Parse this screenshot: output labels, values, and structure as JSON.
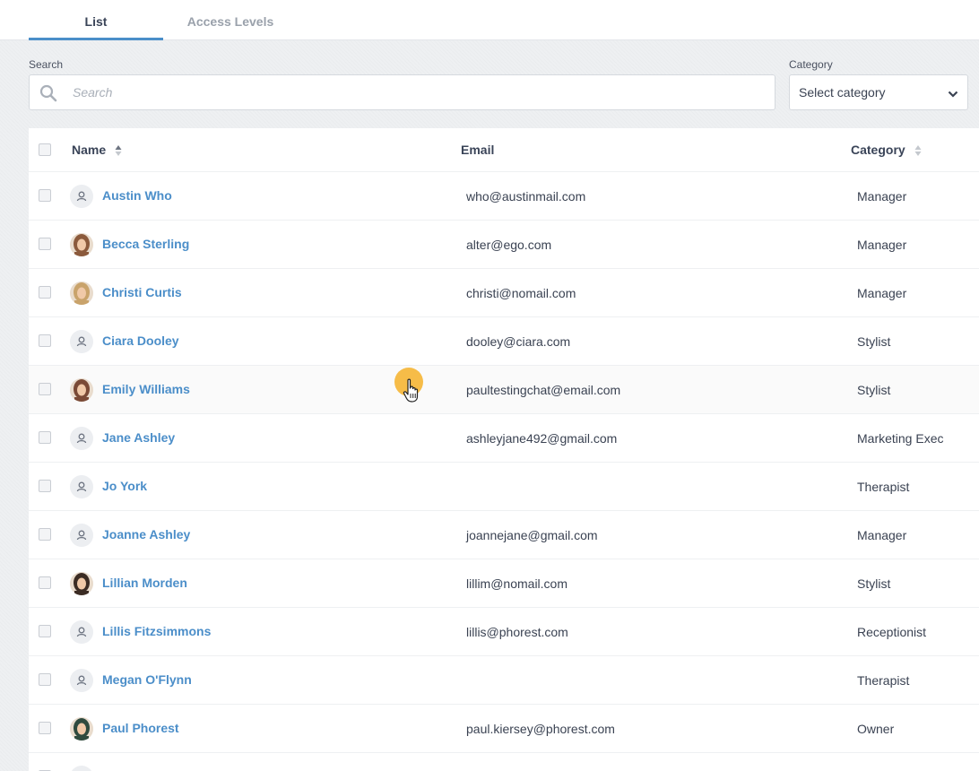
{
  "tabs": [
    {
      "label": "List",
      "active": true
    },
    {
      "label": "Access Levels",
      "active": false
    }
  ],
  "search": {
    "label": "Search",
    "placeholder": "Search",
    "value": ""
  },
  "category_filter": {
    "label": "Category",
    "selected": "Select category"
  },
  "table": {
    "columns": {
      "name": "Name",
      "email": "Email",
      "category": "Category"
    },
    "rows": [
      {
        "name": "Austin Who",
        "email": "who@austinmail.com",
        "category": "Manager",
        "avatar": "placeholder"
      },
      {
        "name": "Becca Sterling",
        "email": "alter@ego.com",
        "category": "Manager",
        "avatar": "photo"
      },
      {
        "name": "Christi Curtis",
        "email": "christi@nomail.com",
        "category": "Manager",
        "avatar": "photo"
      },
      {
        "name": "Ciara Dooley",
        "email": "dooley@ciara.com",
        "category": "Stylist",
        "avatar": "placeholder"
      },
      {
        "name": "Emily Williams",
        "email": "paultestingchat@email.com",
        "category": "Stylist",
        "avatar": "photo"
      },
      {
        "name": "Jane Ashley",
        "email": "ashleyjane492@gmail.com",
        "category": "Marketing Exec",
        "avatar": "placeholder"
      },
      {
        "name": "Jo York",
        "email": "",
        "category": "Therapist",
        "avatar": "placeholder"
      },
      {
        "name": "Joanne Ashley",
        "email": "joannejane@gmail.com",
        "category": "Manager",
        "avatar": "placeholder"
      },
      {
        "name": "Lillian Morden",
        "email": "lillim@nomail.com",
        "category": "Stylist",
        "avatar": "photo"
      },
      {
        "name": "Lillis Fitzsimmons",
        "email": "lillis@phorest.com",
        "category": "Receptionist",
        "avatar": "placeholder"
      },
      {
        "name": "Megan O'Flynn",
        "email": "",
        "category": "Therapist",
        "avatar": "placeholder"
      },
      {
        "name": "Paul Phorest",
        "email": "paul.kiersey@phorest.com",
        "category": "Owner",
        "avatar": "photo"
      }
    ]
  },
  "colors": {
    "accent": "#4b8ec9",
    "cursor_highlight": "#f5b028"
  }
}
